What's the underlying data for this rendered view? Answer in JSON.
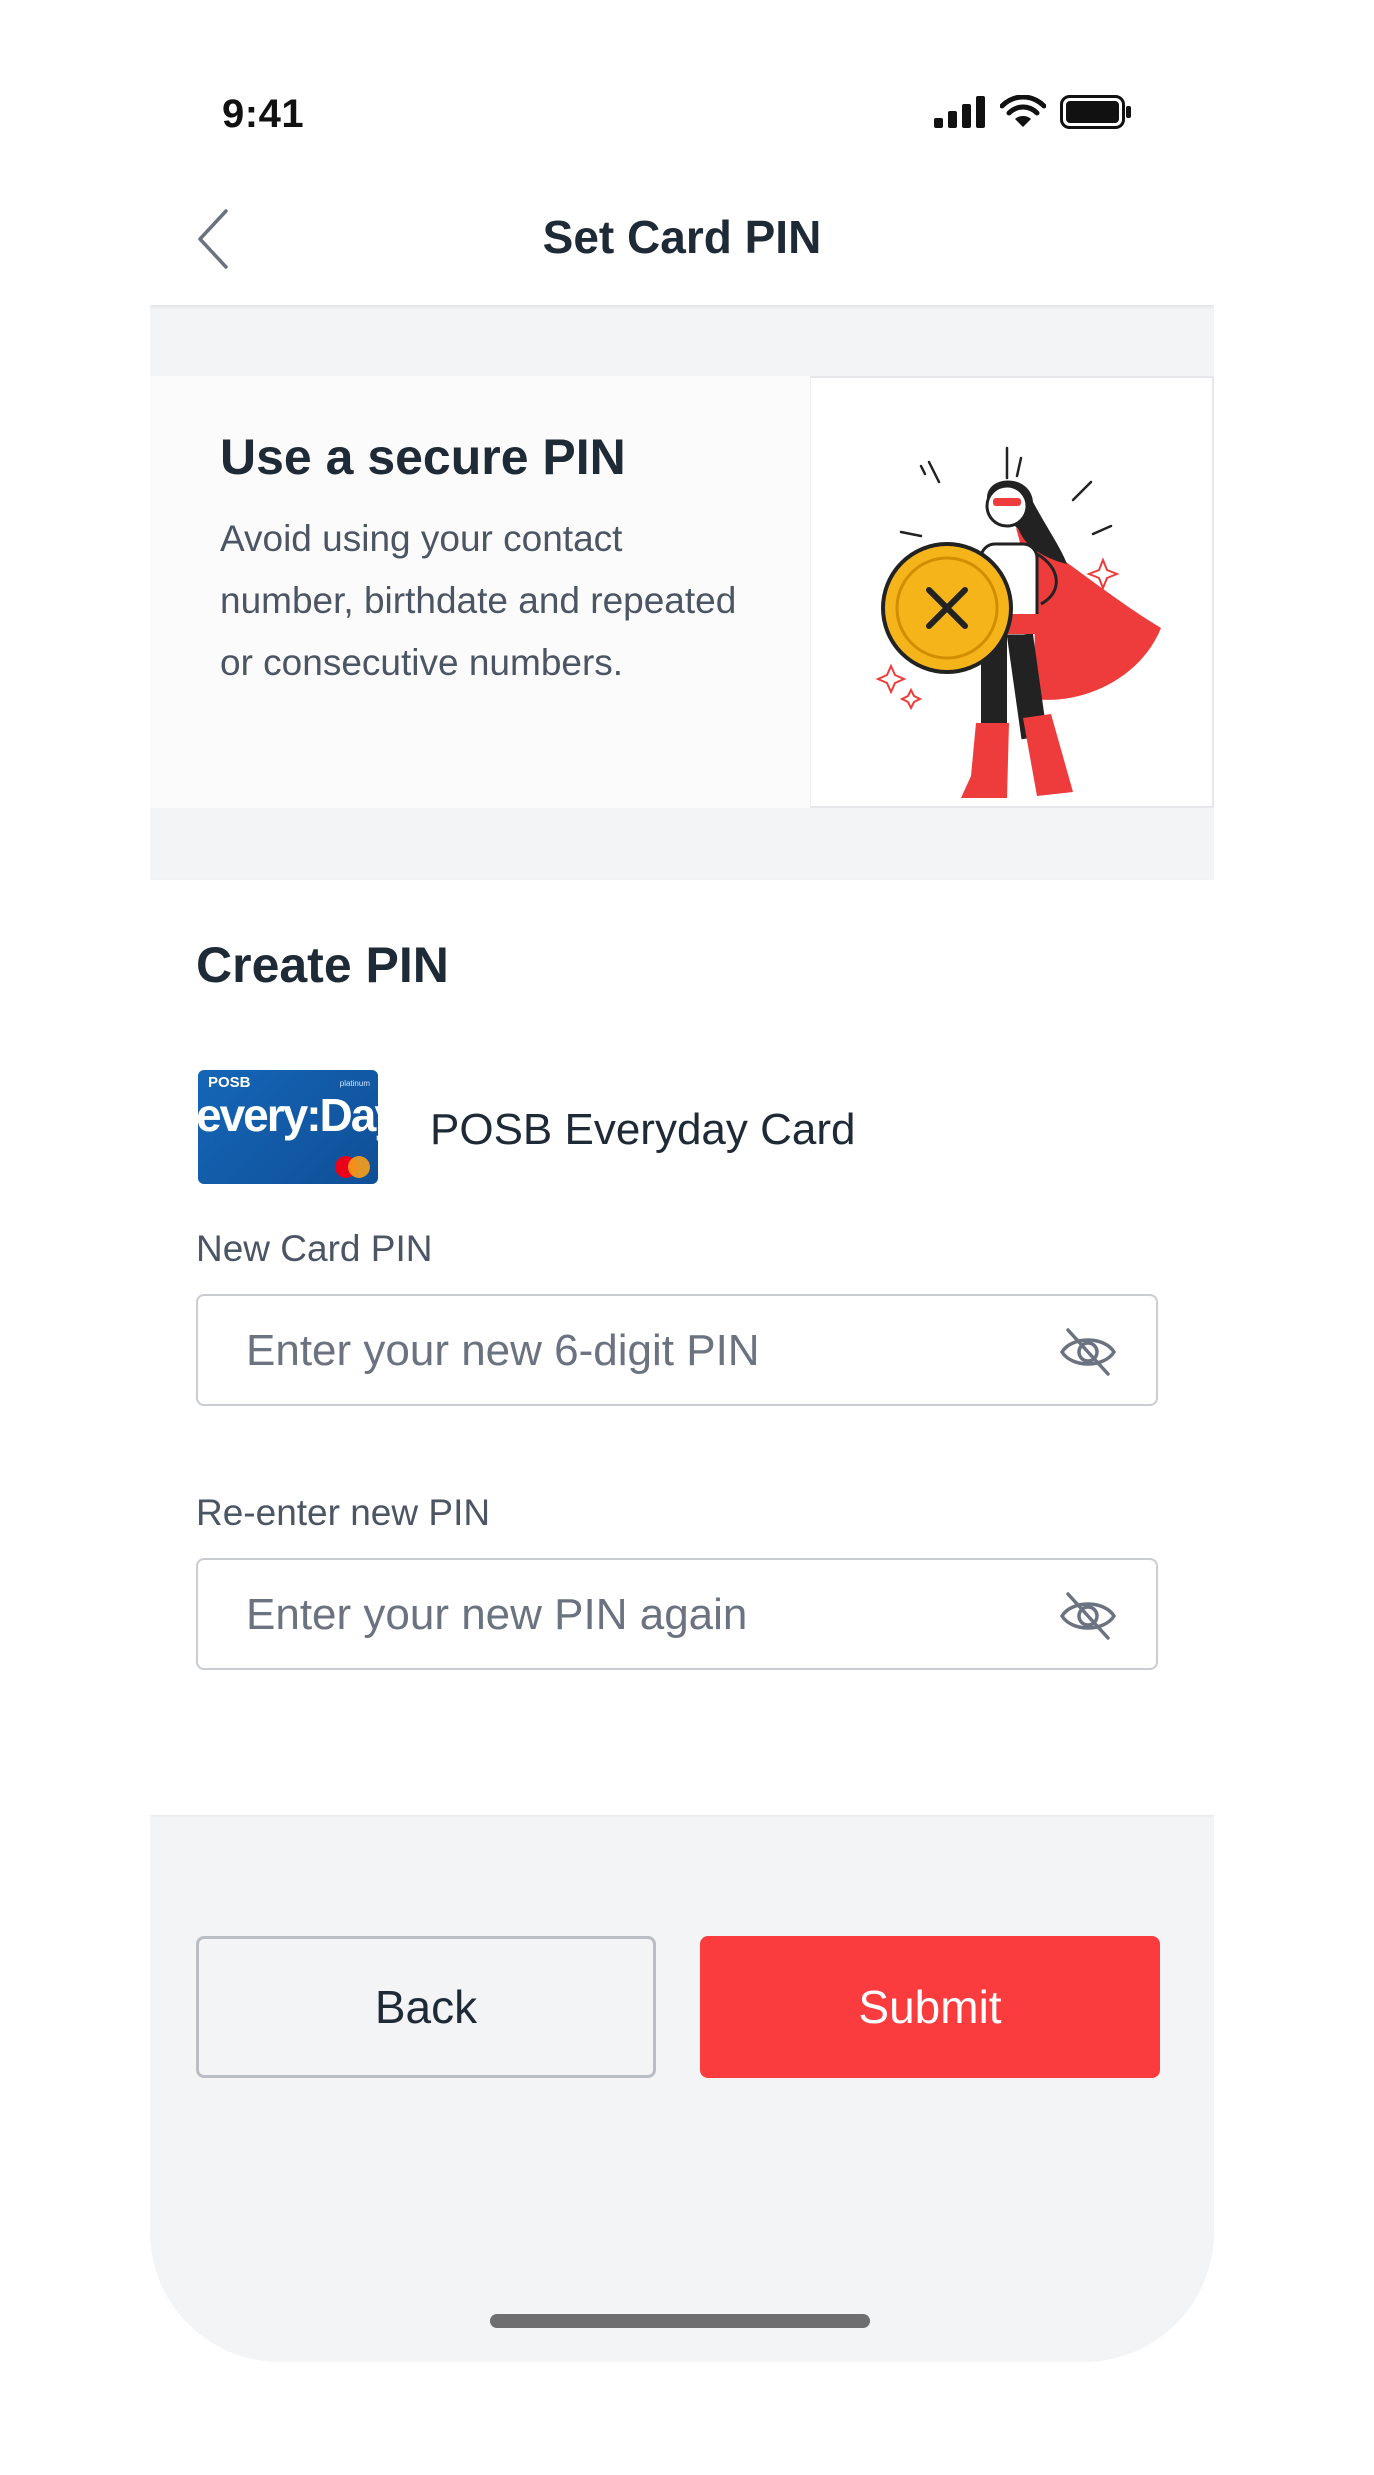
{
  "status_bar": {
    "time": "9:41",
    "icons": [
      "signal-icon",
      "wifi-icon",
      "battery-icon"
    ]
  },
  "header": {
    "title": "Set Card PIN",
    "back_icon": "chevron-left-icon"
  },
  "info": {
    "title": "Use a secure PIN",
    "body": "Avoid using your contact number, birthdate and repeated or consecutive numbers.",
    "illustration": "superhero-with-shield-illustration"
  },
  "create_pin": {
    "title": "Create PIN",
    "card_name": "POSB Everyday Card",
    "card_image_text": {
      "brand": "POSB",
      "tier": "platinum",
      "product": "every:Day"
    }
  },
  "fields": {
    "new_pin": {
      "label": "New Card PIN",
      "placeholder": "Enter your new 6-digit PIN",
      "value": ""
    },
    "reenter_pin": {
      "label": "Re-enter new PIN",
      "placeholder": "Enter your new PIN again",
      "value": ""
    }
  },
  "buttons": {
    "back": "Back",
    "submit": "Submit"
  },
  "colors": {
    "accent_red": "#fa3c3e",
    "text_dark": "#1f2a37",
    "text_muted": "#4b5563",
    "screen_bg": "#f3f4f6"
  }
}
